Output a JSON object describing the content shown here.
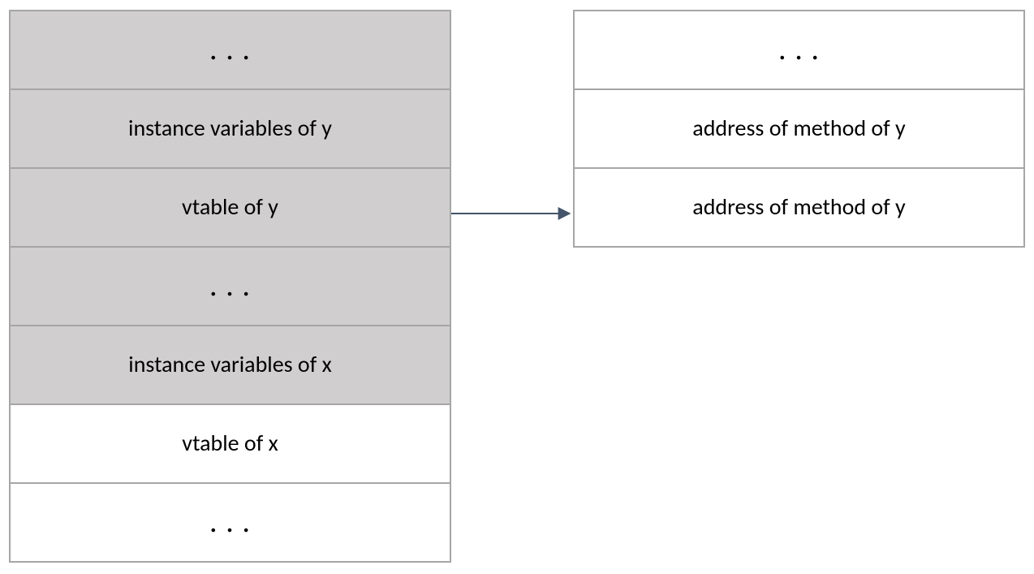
{
  "left_table": {
    "rows": [
      {
        "label": ". . .",
        "shaded": true,
        "is_dots": true
      },
      {
        "label": "instance variables of y",
        "shaded": true,
        "is_dots": false
      },
      {
        "label": "vtable of y",
        "shaded": true,
        "is_dots": false
      },
      {
        "label": ". . .",
        "shaded": true,
        "is_dots": true
      },
      {
        "label": "instance variables of x",
        "shaded": true,
        "is_dots": false
      },
      {
        "label": "vtable of x",
        "shaded": false,
        "is_dots": false
      },
      {
        "label": ". . .",
        "shaded": false,
        "is_dots": true
      }
    ]
  },
  "right_table": {
    "rows": [
      {
        "label": ". . .",
        "is_dots": true
      },
      {
        "label": "address of method of y",
        "is_dots": false
      },
      {
        "label": "address of method of y",
        "is_dots": false
      }
    ]
  },
  "arrow": {
    "from_row_index": 2,
    "to_row_index": 2,
    "stroke": "#44546a"
  }
}
